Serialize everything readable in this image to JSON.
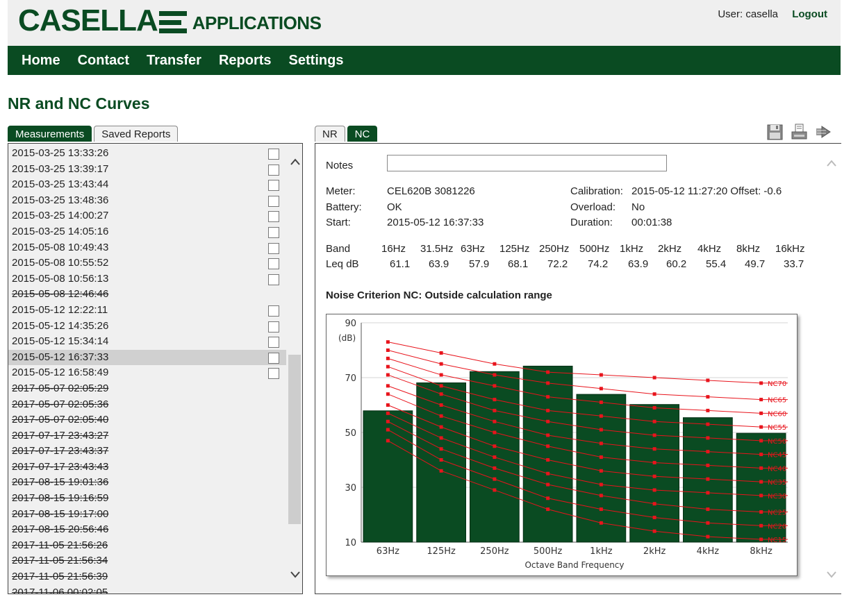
{
  "header": {
    "logo_main": "CASELLA",
    "logo_sub": "APPLICATIONS",
    "user_label": "User: casella",
    "logout_label": "Logout"
  },
  "nav": {
    "items": [
      "Home",
      "Contact",
      "Transfer",
      "Reports",
      "Settings"
    ]
  },
  "page_title": "NR and NC Curves",
  "left_tabs": [
    {
      "label": "Measurements",
      "active": true
    },
    {
      "label": "Saved Reports",
      "active": false
    }
  ],
  "measurements": [
    {
      "t": "2015-03-25 13:33:26",
      "cb": true
    },
    {
      "t": "2015-03-25 13:39:17",
      "cb": true
    },
    {
      "t": "2015-03-25 13:43:44",
      "cb": true
    },
    {
      "t": "2015-03-25 13:48:36",
      "cb": true
    },
    {
      "t": "2015-03-25 14:00:27",
      "cb": true
    },
    {
      "t": "2015-03-25 14:05:16",
      "cb": true
    },
    {
      "t": "2015-05-08 10:49:43",
      "cb": true
    },
    {
      "t": "2015-05-08 10:55:52",
      "cb": true
    },
    {
      "t": "2015-05-08 10:56:13",
      "cb": true
    },
    {
      "t": "2015-05-08 12:46:46",
      "struck": true
    },
    {
      "t": "2015-05-12 12:22:11",
      "cb": true
    },
    {
      "t": "2015-05-12 14:35:26",
      "cb": true
    },
    {
      "t": "2015-05-12 15:34:14",
      "cb": true
    },
    {
      "t": "2015-05-12 16:37:33",
      "cb": true,
      "selected": true
    },
    {
      "t": "2015-05-12 16:58:49",
      "cb": true
    },
    {
      "t": "2017-05-07 02:05:29",
      "struck": true
    },
    {
      "t": "2017-05-07 02:05:36",
      "struck": true
    },
    {
      "t": "2017-05-07 02:05:40",
      "struck": true
    },
    {
      "t": "2017-07-17 23:43:27",
      "struck": true
    },
    {
      "t": "2017-07-17 23:43:37",
      "struck": true
    },
    {
      "t": "2017-07-17 23:43:43",
      "struck": true
    },
    {
      "t": "2017-08-15 19:01:36",
      "struck": true
    },
    {
      "t": "2017-08-15 19:16:59",
      "struck": true
    },
    {
      "t": "2017-08-15 19:17:00",
      "struck": true
    },
    {
      "t": "2017-08-15 20:56:46",
      "struck": true
    },
    {
      "t": "2017-11-05 21:56:26",
      "struck": true
    },
    {
      "t": "2017-11-05 21:56:34",
      "struck": true
    },
    {
      "t": "2017-11-05 21:56:39",
      "struck": true
    },
    {
      "t": "2017-11-06 00:02:05",
      "struck": true
    }
  ],
  "right_tabs": [
    {
      "label": "NR",
      "active": false
    },
    {
      "label": "NC",
      "active": true
    }
  ],
  "toolbar_icons": [
    "save-icon",
    "print-icon",
    "export-icon"
  ],
  "details": {
    "notes_label": "Notes",
    "notes_value": "",
    "meter_label": "Meter:",
    "meter_value": "CEL620B 3081226",
    "battery_label": "Battery:",
    "battery_value": "OK",
    "start_label": "Start:",
    "start_value": "2015-05-12 16:37:33",
    "calibration_label": "Calibration:",
    "calibration_value": "2015-05-12 11:27:20 Offset: -0.6",
    "overload_label": "Overload:",
    "overload_value": "No",
    "duration_label": "Duration:",
    "duration_value": "00:01:38"
  },
  "bands": {
    "band_label": "Band",
    "leq_label": "Leq dB",
    "names": [
      "16Hz",
      "31.5Hz",
      "63Hz",
      "125Hz",
      "250Hz",
      "500Hz",
      "1kHz",
      "2kHz",
      "4kHz",
      "8kHz",
      "16kHz"
    ],
    "values": [
      "61.1",
      "63.9",
      "57.9",
      "68.1",
      "72.2",
      "74.2",
      "63.9",
      "60.2",
      "55.4",
      "49.7",
      "33.7"
    ]
  },
  "nc_result": "Noise Criterion NC: Outside calculation range",
  "colors": {
    "brand": "#0a4b22",
    "curve": "#e8141c"
  },
  "chart_data": {
    "type": "bar",
    "title": "",
    "xlabel": "Octave Band Frequency",
    "ylabel": "(dB)",
    "ylim": [
      10,
      90
    ],
    "yticks": [
      10,
      30,
      50,
      70,
      90
    ],
    "grid": true,
    "categories": [
      "63Hz",
      "125Hz",
      "250Hz",
      "500Hz",
      "1kHz",
      "2kHz",
      "4kHz",
      "8kHz"
    ],
    "values": [
      57.9,
      68.1,
      72.2,
      74.2,
      63.9,
      60.2,
      55.4,
      49.7
    ],
    "curves": [
      {
        "name": "NC70",
        "values": [
          83,
          79,
          75,
          72,
          71,
          70,
          69,
          68
        ]
      },
      {
        "name": "NC65",
        "values": [
          80,
          75,
          71,
          68,
          66,
          64,
          63,
          62
        ]
      },
      {
        "name": "NC60",
        "values": [
          77,
          71,
          67,
          63,
          61,
          59,
          58,
          57
        ]
      },
      {
        "name": "NC55",
        "values": [
          74,
          67,
          62,
          58,
          56,
          54,
          53,
          52
        ]
      },
      {
        "name": "NC50",
        "values": [
          71,
          64,
          58,
          54,
          51,
          49,
          48,
          47
        ]
      },
      {
        "name": "NC45",
        "values": [
          67,
          60,
          54,
          49,
          46,
          44,
          43,
          42
        ]
      },
      {
        "name": "NC40",
        "values": [
          64,
          56,
          50,
          45,
          41,
          39,
          38,
          37
        ]
      },
      {
        "name": "NC35",
        "values": [
          60,
          52,
          45,
          40,
          36,
          34,
          33,
          32
        ]
      },
      {
        "name": "NC30",
        "values": [
          57,
          48,
          41,
          35,
          31,
          29,
          28,
          27
        ]
      },
      {
        "name": "NC25",
        "values": [
          54,
          44,
          37,
          31,
          27,
          24,
          22,
          21
        ]
      },
      {
        "name": "NC20",
        "values": [
          51,
          40,
          33,
          26,
          22,
          19,
          17,
          16
        ]
      },
      {
        "name": "NC15",
        "values": [
          47,
          36,
          29,
          22,
          17,
          14,
          12,
          11
        ]
      }
    ]
  }
}
